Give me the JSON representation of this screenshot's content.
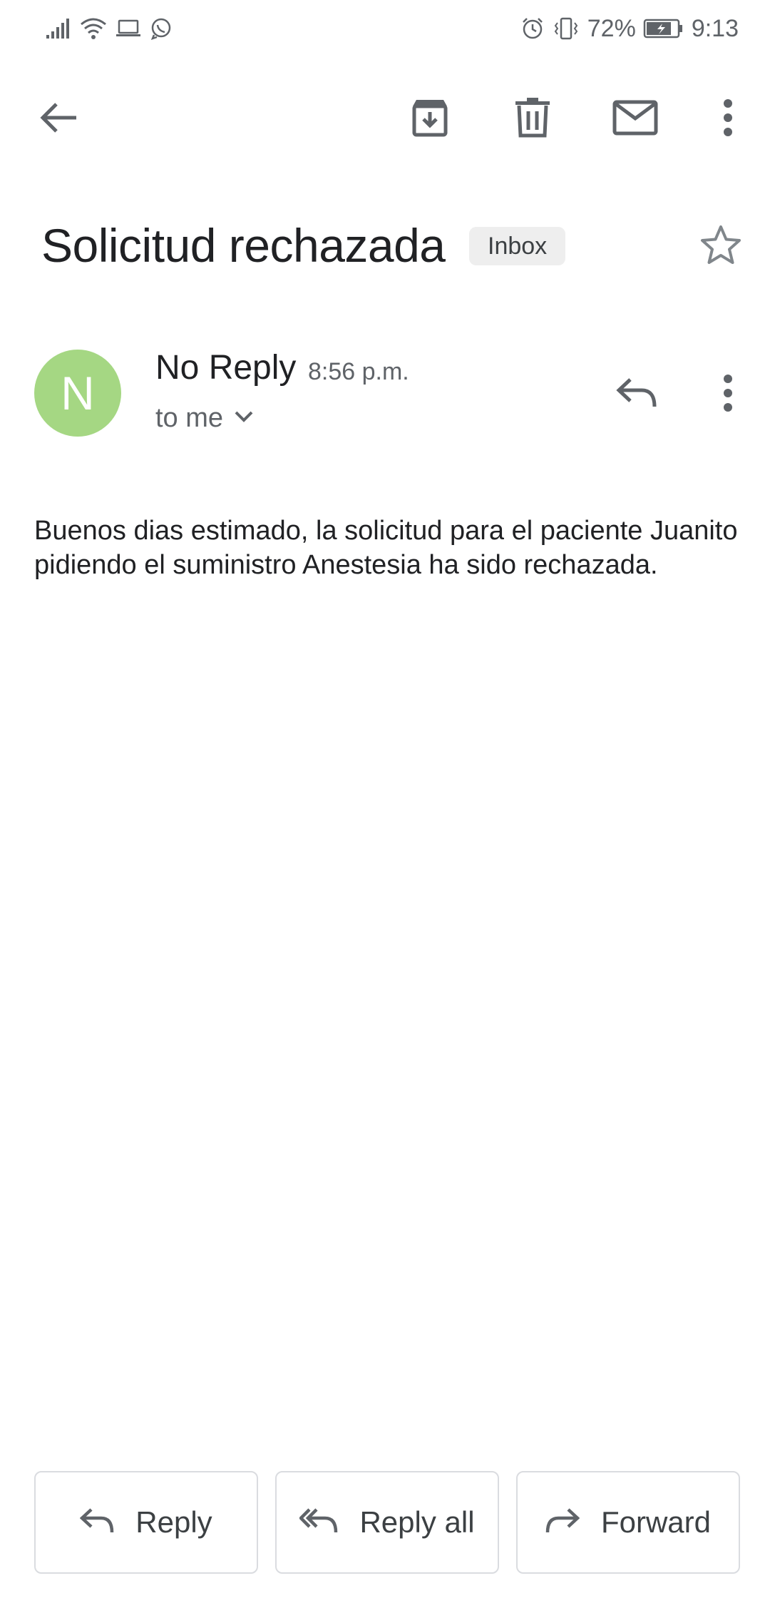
{
  "status_bar": {
    "battery": "72%",
    "time": "9:13"
  },
  "toolbar": {
    "back_icon": "arrow-back-icon",
    "archive_icon": "archive-icon",
    "delete_icon": "delete-icon",
    "mark_unread_icon": "mail-icon",
    "more_icon": "more-vert-icon"
  },
  "email": {
    "subject": "Solicitud rechazada",
    "label": "Inbox",
    "starred": false,
    "sender": {
      "avatar_letter": "N",
      "avatar_color": "#a5d783",
      "name": "No Reply",
      "time": "8:56 p.m.",
      "recipient": "to me"
    },
    "body": "Buenos dias estimado, la solicitud para el paciente Juanito pidiendo el suministro Anestesia ha sido rechazada."
  },
  "actions": {
    "reply": "Reply",
    "reply_all": "Reply all",
    "forward": "Forward"
  }
}
